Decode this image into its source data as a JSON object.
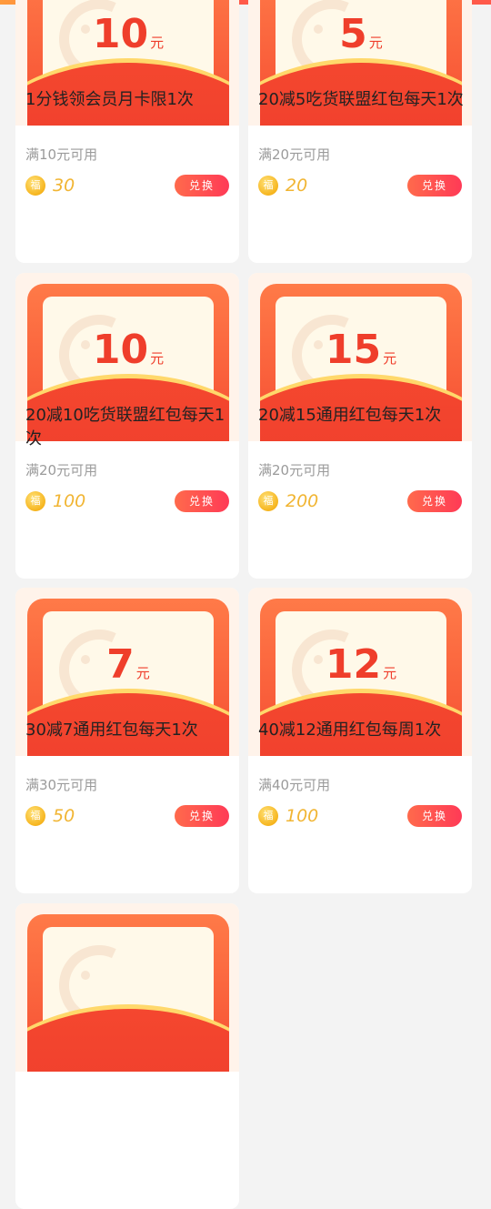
{
  "coupons": [
    {
      "amount": "10",
      "unit": "元",
      "title": "1分钱领会员月卡限1次",
      "condition": "满10元可用",
      "cost": "30",
      "button": "兑换"
    },
    {
      "amount": "5",
      "unit": "元",
      "title": "20减5吃货联盟红包每天1次",
      "condition": "满20元可用",
      "cost": "20",
      "button": "兑换"
    },
    {
      "amount": "10",
      "unit": "元",
      "title": "20减10吃货联盟红包每天1次",
      "condition": "满20元可用",
      "cost": "100",
      "button": "兑换"
    },
    {
      "amount": "15",
      "unit": "元",
      "title": "20减15通用红包每天1次",
      "condition": "满20元可用",
      "cost": "200",
      "button": "兑换"
    },
    {
      "amount": "7",
      "unit": "元",
      "title": "30减7通用红包每天1次",
      "condition": "满30元可用",
      "cost": "50",
      "button": "兑换"
    },
    {
      "amount": "12",
      "unit": "元",
      "title": "40减12通用红包每周1次",
      "condition": "满40元可用",
      "cost": "100",
      "button": "兑换"
    }
  ],
  "coin_glyph": "福",
  "colors": {
    "accent": "#ef3e2b",
    "gold": "#f1b533",
    "button": "#ff4a52"
  }
}
